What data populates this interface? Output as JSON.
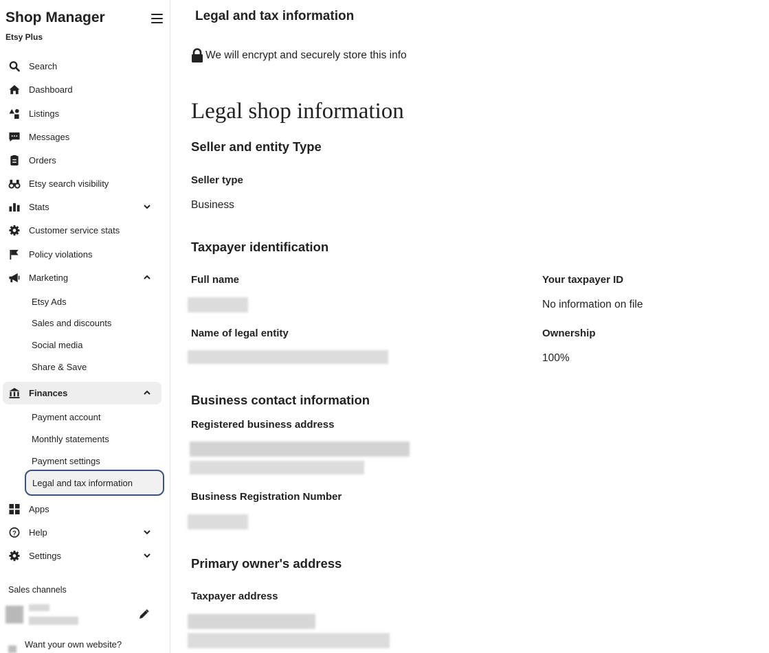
{
  "sidebar": {
    "title": "Shop Manager",
    "subtitle": "Etsy Plus",
    "items": [
      {
        "label": "Search",
        "icon": "search-icon"
      },
      {
        "label": "Dashboard",
        "icon": "home-icon"
      },
      {
        "label": "Listings",
        "icon": "shapes-icon"
      },
      {
        "label": "Messages",
        "icon": "chat-icon"
      },
      {
        "label": "Orders",
        "icon": "clipboard-icon"
      },
      {
        "label": "Etsy search visibility",
        "icon": "binoculars-icon"
      },
      {
        "label": "Stats",
        "icon": "bar-chart-icon",
        "chevron": "down"
      },
      {
        "label": "Customer service stats",
        "icon": "gear-icon"
      },
      {
        "label": "Policy violations",
        "icon": "flag-icon"
      },
      {
        "label": "Marketing",
        "icon": "megaphone-icon",
        "chevron": "up"
      }
    ],
    "marketing_sub": [
      "Etsy Ads",
      "Sales and discounts",
      "Social media",
      "Share & Save"
    ],
    "finances": {
      "label": "Finances",
      "icon": "bank-icon",
      "chevron": "up"
    },
    "finances_sub": [
      "Payment account",
      "Monthly statements",
      "Payment settings",
      "Legal and tax information"
    ],
    "bottom_items": [
      {
        "label": "Apps",
        "icon": "grid-icon"
      },
      {
        "label": "Help",
        "icon": "question-icon",
        "chevron": "down"
      },
      {
        "label": "Settings",
        "icon": "gear-icon",
        "chevron": "down"
      }
    ],
    "sales_channels_label": "Sales channels",
    "want_website": "Want your own website?"
  },
  "main": {
    "page_title": "Legal and tax information",
    "secure_note": "We will encrypt and securely store this info",
    "heading": "Legal shop information",
    "seller_section": "Seller and entity Type",
    "seller_type_label": "Seller type",
    "seller_type_value": "Business",
    "taxpayer_section": "Taxpayer identification",
    "full_name_label": "Full name",
    "taxpayer_id_label": "Your taxpayer ID",
    "taxpayer_id_value": "No information on file",
    "legal_entity_label": "Name of legal entity",
    "ownership_label": "Ownership",
    "ownership_value": "100%",
    "contact_section": "Business contact information",
    "reg_address_label": "Registered business address",
    "reg_number_label": "Business Registration Number",
    "owner_section": "Primary owner's address",
    "taxpayer_address_label": "Taxpayer address"
  },
  "colors": {
    "accent_border": "#3b5280",
    "selected_bg": "#eeeeee",
    "divider": "#e1e3df"
  }
}
